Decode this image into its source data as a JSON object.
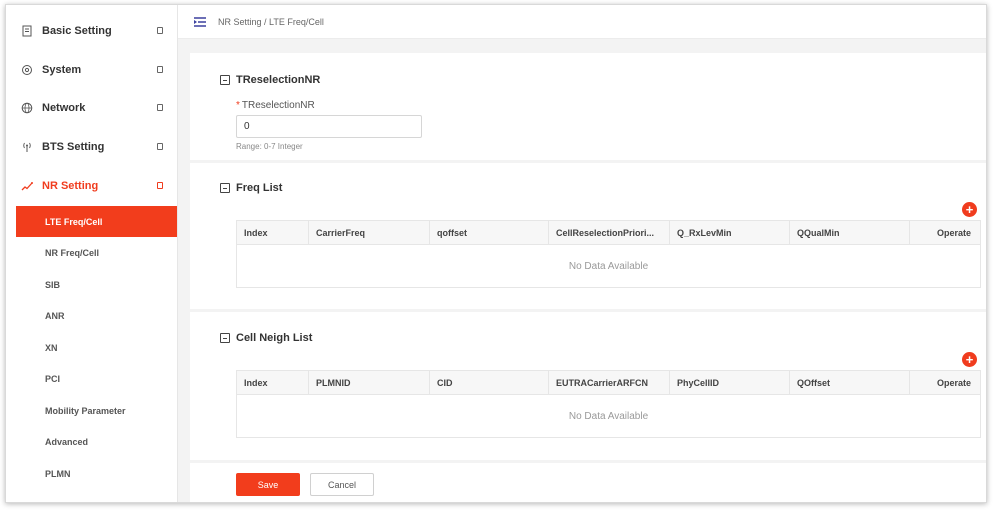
{
  "sidebar": {
    "menu": [
      {
        "label": "Basic Setting",
        "icon": "document-icon"
      },
      {
        "label": "System",
        "icon": "gear-icon"
      },
      {
        "label": "Network",
        "icon": "globe-icon"
      },
      {
        "label": "BTS Setting",
        "icon": "antenna-icon"
      },
      {
        "label": "NR Setting",
        "icon": "signal-icon"
      }
    ],
    "submenu": [
      {
        "label": "LTE Freq/Cell"
      },
      {
        "label": "NR Freq/Cell"
      },
      {
        "label": "SIB"
      },
      {
        "label": "ANR"
      },
      {
        "label": "XN"
      },
      {
        "label": "PCI"
      },
      {
        "label": "Mobility Parameter"
      },
      {
        "label": "Advanced"
      },
      {
        "label": "PLMN"
      }
    ]
  },
  "header": {
    "breadcrumb": "NR Setting / LTE Freq/Cell"
  },
  "treselection": {
    "title": "TReselectionNR",
    "required_mark": "*",
    "field_label": "TReselectionNR",
    "value": "0",
    "hint": "Range: 0-7 Integer"
  },
  "freq_list": {
    "title": "Freq List",
    "add_symbol": "+",
    "columns": [
      "Index",
      "CarrierFreq",
      "qoffset",
      "CellReselectionPriori...",
      "Q_RxLevMin",
      "QQualMin",
      "Operate"
    ],
    "empty_text": "No Data Available"
  },
  "cell_neigh_list": {
    "title": "Cell Neigh List",
    "add_symbol": "+",
    "columns": [
      "Index",
      "PLMNID",
      "CID",
      "EUTRACarrierARFCN",
      "PhyCellID",
      "QOffset",
      "Operate"
    ],
    "empty_text": "No Data Available"
  },
  "actions": {
    "save_label": "Save",
    "cancel_label": "Cancel"
  },
  "colors": {
    "accent": "#f23d1c"
  }
}
